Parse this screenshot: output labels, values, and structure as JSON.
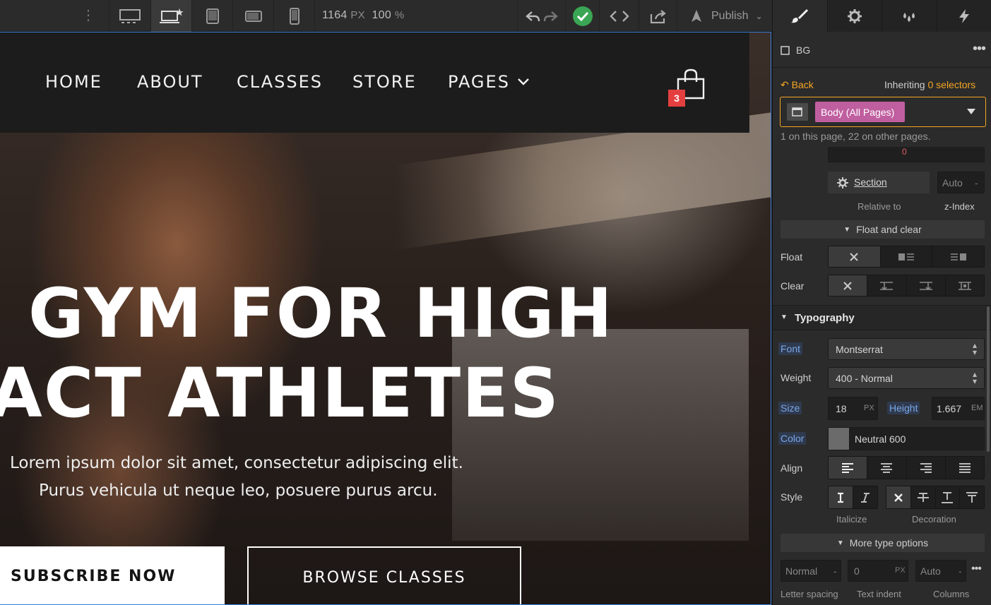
{
  "toolbar": {
    "width_value": "1164",
    "width_unit": "PX",
    "zoom_value": "100",
    "zoom_unit": "%",
    "publish_label": "Publish"
  },
  "site": {
    "nav": [
      "HOME",
      "ABOUT",
      "CLASSES",
      "STORE",
      "PAGES"
    ],
    "cart_count": "3",
    "headline_line1": "GYM FOR HIGH",
    "headline_line2": "PACT ATHLETES",
    "subtitle_line1": "Lorem ipsum dolor sit amet, consectetur adipiscing elit.",
    "subtitle_line2": "Purus vehicula ut neque leo, posuere purus arcu.",
    "subscribe_label": "SUBSCRIBE NOW",
    "browse_label": "BROWSE CLASSES"
  },
  "panel": {
    "element_name": "BG",
    "back_label": "Back",
    "inheriting_text": "Inheriting",
    "inheriting_count": "0 selectors",
    "selector_tag": "Body (All Pages)",
    "selector_usage": "1 on this page, 22 on other pages.",
    "clipped_value": "0",
    "section_label": "Section",
    "relative_to_label": "Relative to",
    "z_index_value": "Auto",
    "z_index_unit": "-",
    "z_index_label": "z-Index",
    "float_clear_header": "Float and clear",
    "float_label": "Float",
    "clear_label": "Clear",
    "typography_header": "Typography",
    "font_label": "Font",
    "font_value": "Montserrat",
    "weight_label": "Weight",
    "weight_value": "400 - Normal",
    "size_label": "Size",
    "size_value": "18",
    "size_unit": "PX",
    "height_label": "Height",
    "height_value": "1.667",
    "height_unit": "EM",
    "color_label": "Color",
    "color_value": "Neutral 600",
    "color_swatch": "#6b6b6b",
    "align_label": "Align",
    "style_label": "Style",
    "italicize_label": "Italicize",
    "decoration_label": "Decoration",
    "more_type_label": "More type options",
    "letter_spacing_value": "Normal",
    "letter_spacing_unit": "-",
    "text_indent_value": "0",
    "text_indent_unit": "PX",
    "columns_value": "Auto",
    "columns_unit": "-",
    "letter_spacing_label": "Letter spacing",
    "text_indent_label": "Text indent",
    "columns_label": "Columns",
    "accent_orange": "#f5a623",
    "tag_pink": "#c05fa0"
  }
}
